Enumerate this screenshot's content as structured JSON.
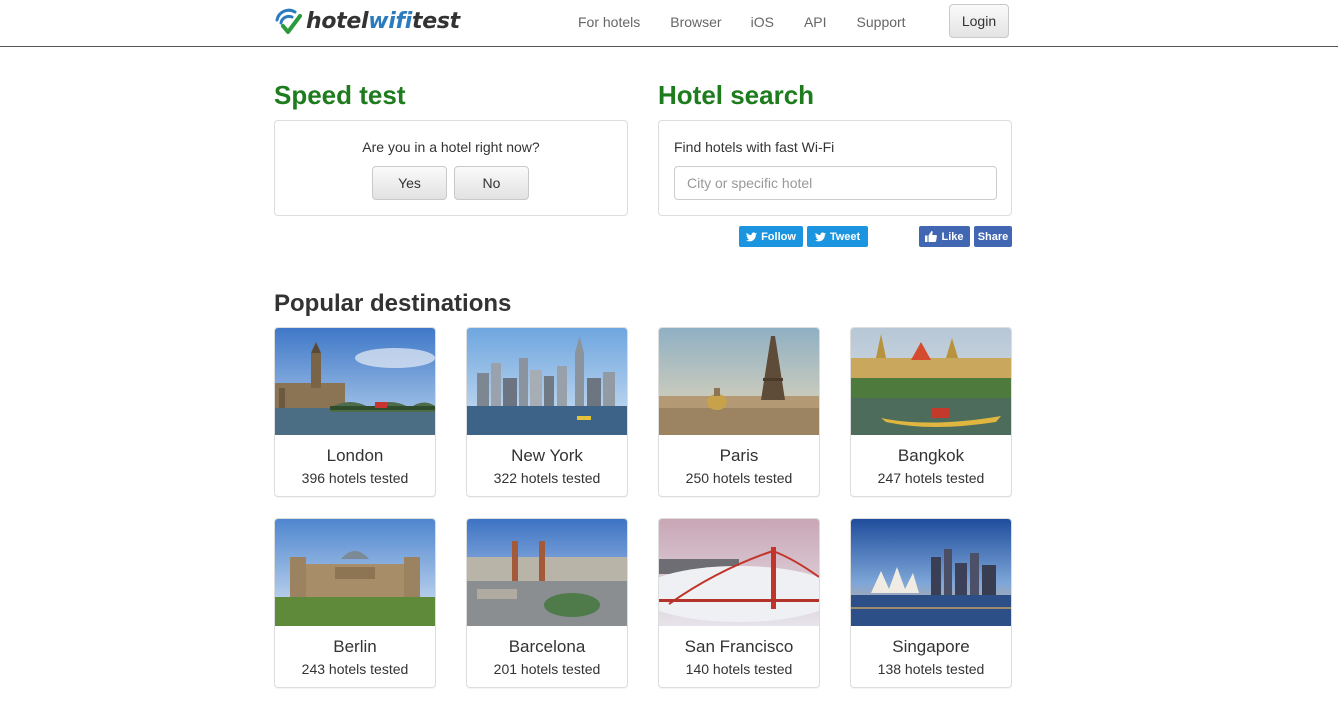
{
  "header": {
    "logo_part1": "hotel",
    "logo_part2": "wifi",
    "logo_part3": "test",
    "nav": [
      "For hotels",
      "Browser",
      "iOS",
      "API",
      "Support"
    ],
    "login_label": "Login"
  },
  "speed_test": {
    "title": "Speed test",
    "question": "Are you in a hotel right now?",
    "yes_label": "Yes",
    "no_label": "No"
  },
  "hotel_search": {
    "title": "Hotel search",
    "label": "Find hotels with fast Wi-Fi",
    "value": "",
    "placeholder": "City or specific hotel"
  },
  "social": {
    "follow_label": "Follow",
    "tweet_label": "Tweet",
    "like_label": "Like",
    "share_label": "Share"
  },
  "destinations": {
    "title": "Popular destinations",
    "items": [
      {
        "city": "London",
        "count": "396 hotels tested"
      },
      {
        "city": "New York",
        "count": "322 hotels tested"
      },
      {
        "city": "Paris",
        "count": "250 hotels tested"
      },
      {
        "city": "Bangkok",
        "count": "247 hotels tested"
      },
      {
        "city": "Berlin",
        "count": "243 hotels tested"
      },
      {
        "city": "Barcelona",
        "count": "201 hotels tested"
      },
      {
        "city": "San Francisco",
        "count": "140 hotels tested"
      },
      {
        "city": "Singapore",
        "count": "138 hotels tested"
      }
    ]
  },
  "colors": {
    "heading_green": "#1e7c1e",
    "twitter_blue": "#1b95e0",
    "facebook_blue": "#4267b2",
    "logo_blue": "#2b7bbf"
  }
}
